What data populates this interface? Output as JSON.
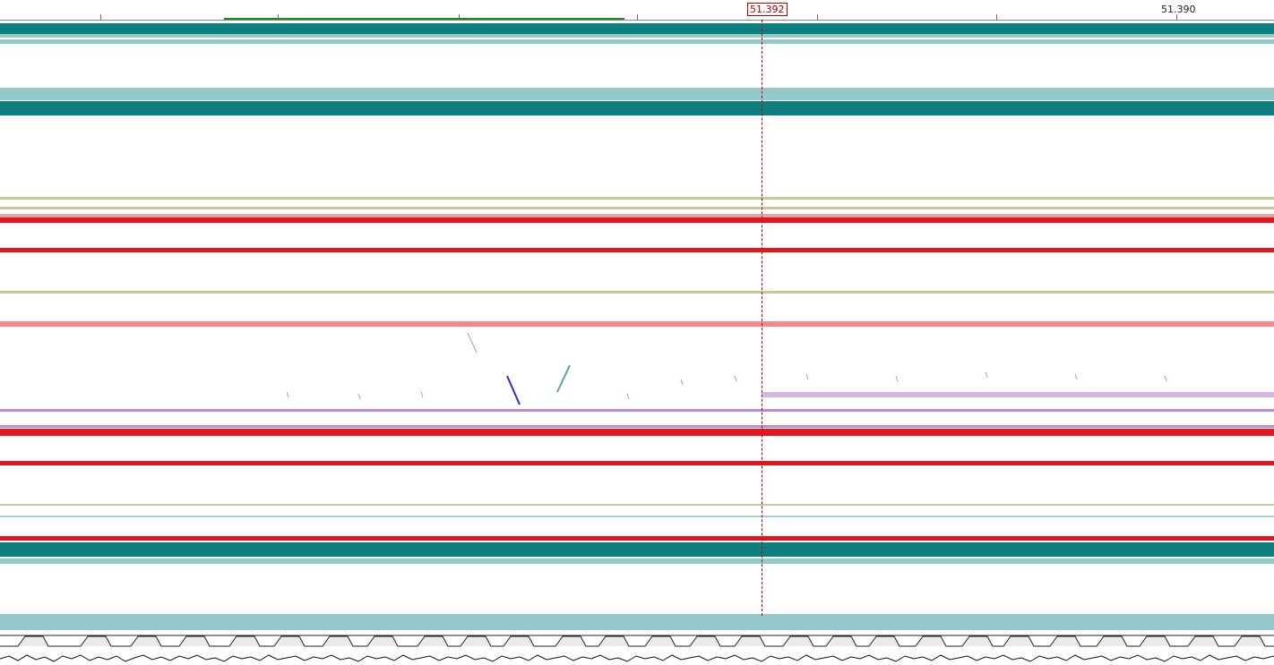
{
  "ruler": {
    "labels": [
      "51.390"
    ],
    "cursor_label": "51.392"
  },
  "colors": {
    "teal_dark": "#0e7f7f",
    "teal_light": "#93c9cb",
    "red": "#e8141c",
    "pink": "#f2a1a1",
    "olive": "#c6c79a",
    "purple": "#b98fd1",
    "blue": "#2b32c8",
    "cursor": "#b00000",
    "region_green": "#1a8a1a"
  }
}
